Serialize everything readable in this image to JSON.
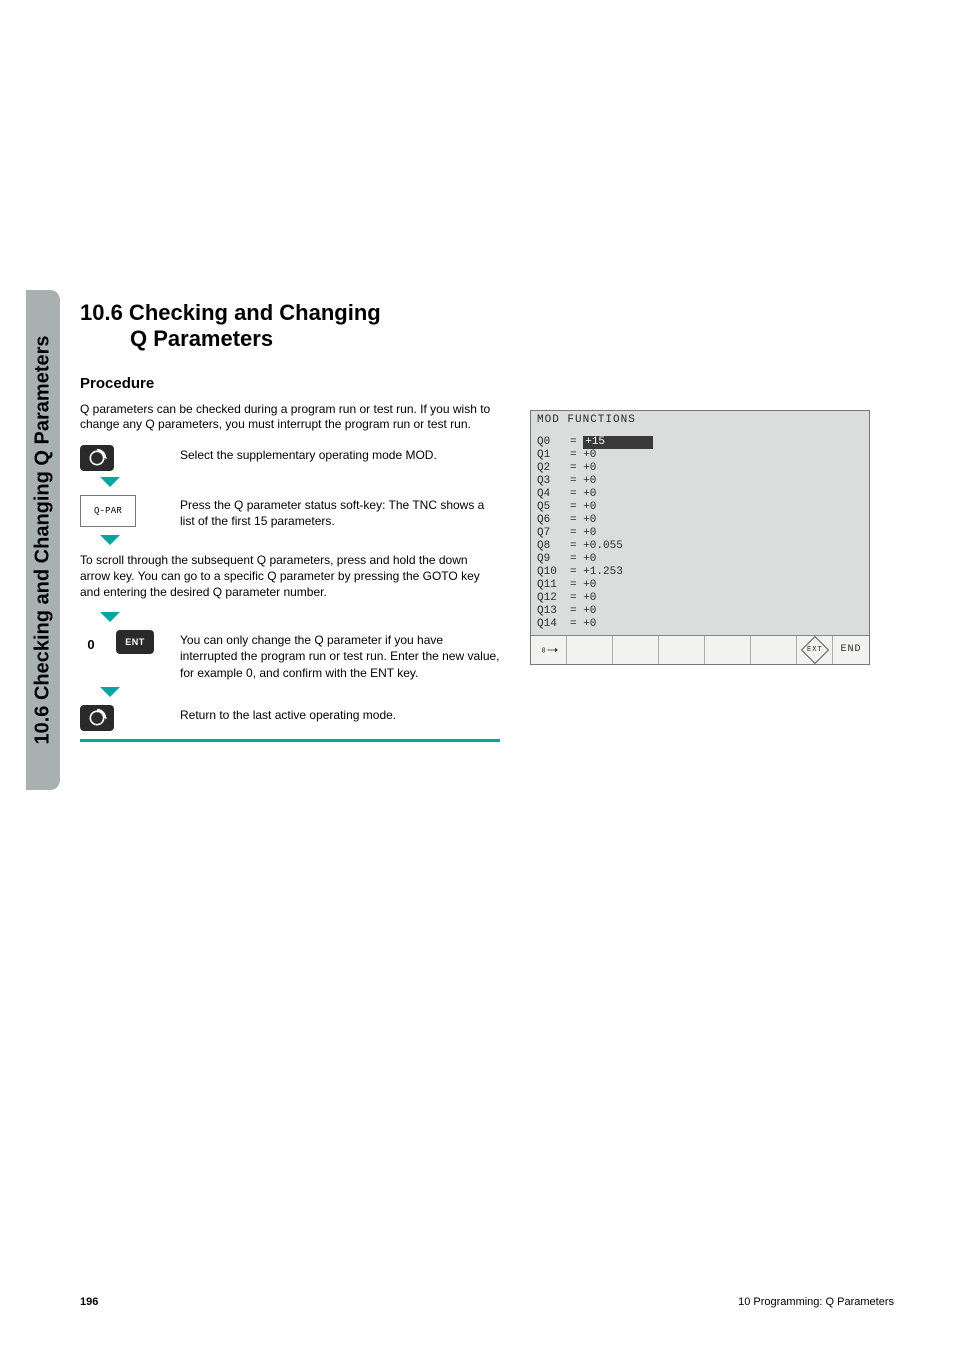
{
  "sidetab": {
    "label": "10.6 Checking and Changing Q Parameters"
  },
  "heading": {
    "line1": "10.6 Checking and Changing",
    "line2": "Q Parameters"
  },
  "subheading": "Procedure",
  "intro": "Q parameters can be checked during a program run or test run. If you wish to change any Q parameters, you must interrupt the program run or test run.",
  "steps": {
    "mod": {
      "text": "Select the supplementary operating mode MOD."
    },
    "qpar": {
      "key_label": "Q-PAR",
      "text": "Press the Q parameter status soft-key: The TNC shows a list of the first 15 parameters."
    },
    "scroll_para": "To scroll through the subsequent Q parameters, press and hold the down arrow key. You can go to a specific Q parameter by pressing the GOTO key and entering the desired Q parameter number.",
    "ent": {
      "zero": "0",
      "key_label": "ENT",
      "text": "You can only change the Q parameter if you have interrupted the program run or test run. Enter the new value, for example 0, and confirm with the ENT key."
    },
    "mod2": {
      "text": "Return to the last active operating mode."
    }
  },
  "screen": {
    "title": "MOD FUNCTIONS",
    "rows": [
      {
        "q": "Q0",
        "eq": "=",
        "val": "+15",
        "hl": true
      },
      {
        "q": "Q1",
        "eq": "=",
        "val": "+0"
      },
      {
        "q": "Q2",
        "eq": "=",
        "val": "+0"
      },
      {
        "q": "Q3",
        "eq": "=",
        "val": "+0"
      },
      {
        "q": "Q4",
        "eq": "=",
        "val": "+0"
      },
      {
        "q": "Q5",
        "eq": "=",
        "val": "+0"
      },
      {
        "q": "Q6",
        "eq": "=",
        "val": "+0"
      },
      {
        "q": "Q7",
        "eq": "=",
        "val": "+0"
      },
      {
        "q": "Q8",
        "eq": "=",
        "val": "+0.055"
      },
      {
        "q": "Q9",
        "eq": "=",
        "val": "+0"
      },
      {
        "q": "Q10",
        "eq": "=",
        "val": "+1.253"
      },
      {
        "q": "Q11",
        "eq": "=",
        "val": "+0"
      },
      {
        "q": "Q12",
        "eq": "=",
        "val": "+0"
      },
      {
        "q": "Q13",
        "eq": "=",
        "val": "+0"
      },
      {
        "q": "Q14",
        "eq": "=",
        "val": "+0"
      }
    ],
    "softkeys": {
      "ext": "EXT",
      "end": "END"
    }
  },
  "footer": {
    "page": "196",
    "chapter": "10 Programming: Q Parameters"
  }
}
